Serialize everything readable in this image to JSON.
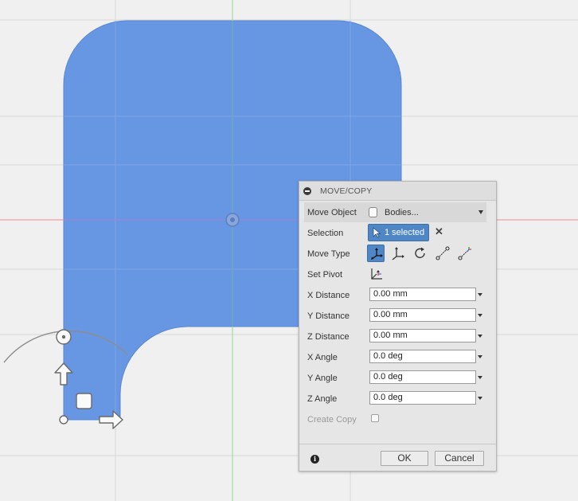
{
  "dialog": {
    "title": "MOVE/COPY",
    "move_object": {
      "label": "Move Object",
      "value": "Bodies..."
    },
    "selection": {
      "label": "Selection",
      "value": "1 selected"
    },
    "move_type": {
      "label": "Move Type",
      "options": [
        "free-move",
        "translate",
        "rotate",
        "point-to-point",
        "point-to-position"
      ],
      "active": "free-move"
    },
    "set_pivot": {
      "label": "Set Pivot"
    },
    "x_distance": {
      "label": "X Distance",
      "value": "0.00 mm"
    },
    "y_distance": {
      "label": "Y Distance",
      "value": "0.00 mm"
    },
    "z_distance": {
      "label": "Z Distance",
      "value": "0.00 mm"
    },
    "x_angle": {
      "label": "X Angle",
      "value": "0.0 deg"
    },
    "y_angle": {
      "label": "Y Angle",
      "value": "0.0 deg"
    },
    "z_angle": {
      "label": "Z Angle",
      "value": "0.0 deg"
    },
    "create_copy": {
      "label": "Create Copy",
      "checked": false,
      "enabled": false
    },
    "ok_label": "OK",
    "cancel_label": "Cancel"
  },
  "colors": {
    "body_fill": "#6797e3",
    "axis_x": "#f08a8a",
    "axis_y": "#8fd68f",
    "accent": "#4f86c6",
    "background": "#f0f0f0"
  }
}
